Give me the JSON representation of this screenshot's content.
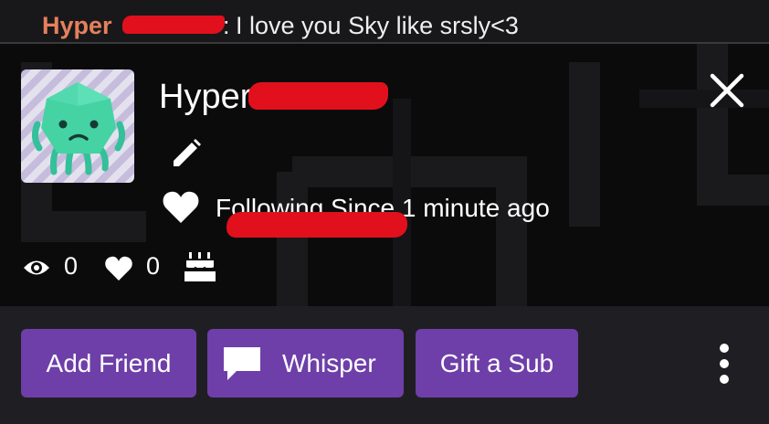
{
  "chat": {
    "username_visible": "Hyper",
    "colon": ":",
    "message": "I love you Sky like srsly<3"
  },
  "card": {
    "display_name_visible": "Hyper",
    "following_text": "Following Since 1 minute ago",
    "stats": {
      "views": "0",
      "followers": "0"
    },
    "icons": {
      "close": "close-icon",
      "edit": "pencil-icon",
      "follow": "heart-icon",
      "views": "eye-icon",
      "followers": "heart-icon",
      "created": "cake-icon"
    }
  },
  "actions": {
    "add_friend": "Add Friend",
    "whisper": "Whisper",
    "gift_sub": "Gift a Sub",
    "more_icon": "vertical-dots-icon"
  },
  "colors": {
    "chat_username": "#e5805c",
    "button_bg": "#6e3fa8",
    "redaction": "#e1101c",
    "avatar_mascot": "#45d3a4"
  }
}
